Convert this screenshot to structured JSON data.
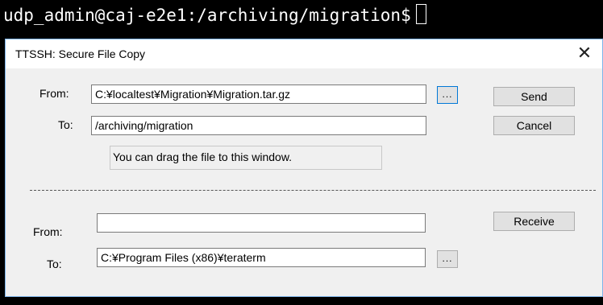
{
  "terminal": {
    "prompt": "udp_admin@caj-e2e1:/archiving/migration$"
  },
  "dialog": {
    "title": "TTSSH: Secure File Copy",
    "close_icon": "close-icon",
    "send_section": {
      "from_label": "From:",
      "from_value": "C:¥localtest¥Migration¥Migration.tar.gz",
      "browse_label": "...",
      "to_label": "To:",
      "to_value": "/archiving/migration",
      "hint": "You can drag the file to this window.",
      "send_label": "Send",
      "cancel_label": "Cancel"
    },
    "receive_section": {
      "from_label": "From:",
      "from_value": "",
      "to_label": "To:",
      "to_value": "C:¥Program Files (x86)¥teraterm",
      "browse_label": "...",
      "receive_label": "Receive"
    }
  },
  "colors": {
    "terminal_background": "#000000",
    "dialog_background": "#f0f0f0",
    "focus_border": "#0078d7"
  }
}
